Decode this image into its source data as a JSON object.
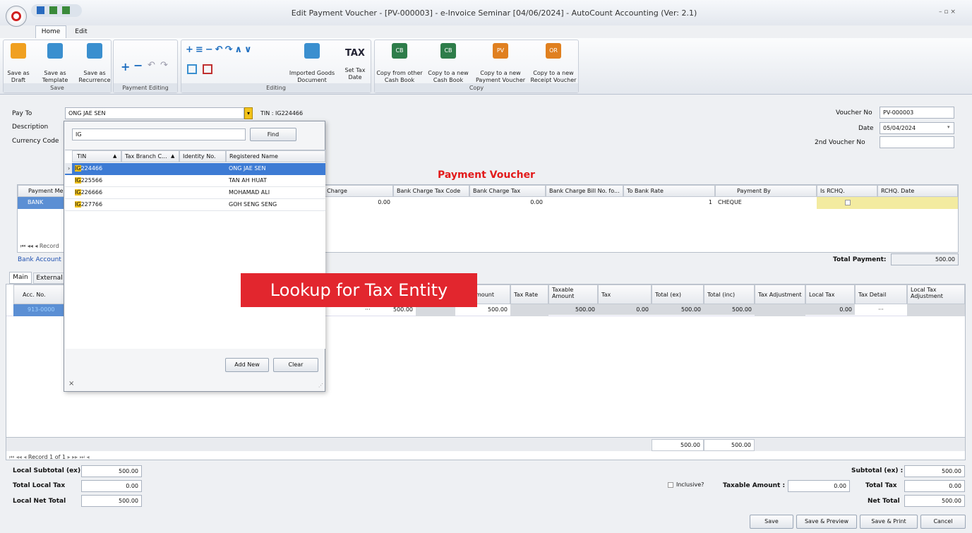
{
  "window": {
    "title": "Edit Payment Voucher - [PV-000003] - e-Invoice Seminar [04/06/2024] - AutoCount Accounting (Ver: 2.1)",
    "controls": "– ▫ ×"
  },
  "tabs": [
    "Home",
    "Edit"
  ],
  "ribbon": {
    "save_group": "Save",
    "save_draft": [
      "Save as",
      "Draft"
    ],
    "save_template": [
      "Save as",
      "Template"
    ],
    "save_recurrence": [
      "Save as",
      "Recurrence"
    ],
    "payment_editing": "Payment Editing",
    "editing": "Editing",
    "imported_goods": [
      "Imported Goods",
      "Document"
    ],
    "set_tax_date": [
      "Set Tax",
      "Date"
    ],
    "copy_group": "Copy",
    "copy_from_cash": [
      "Copy from other",
      "Cash Book"
    ],
    "copy_new_cash": [
      "Copy to a new",
      "Cash Book"
    ],
    "copy_new_pv": [
      "Copy to a new",
      "Payment Voucher"
    ],
    "copy_new_rv": [
      "Copy to a new",
      "Receipt Voucher"
    ],
    "tax_icon": "TAX",
    "cb": "CB",
    "pv": "PV",
    "or": "OR"
  },
  "form": {
    "pay_to_label": "Pay To",
    "pay_to_value": "ONG JAE SEN",
    "tin": "TIN : IG224466",
    "description_label": "Description",
    "currency_label": "Currency Code",
    "voucher_no_label": "Voucher No",
    "voucher_no": "PV-000003",
    "date_label": "Date",
    "date": "05/04/2024",
    "second_voucher_label": "2nd Voucher No"
  },
  "doc_title": "Payment Voucher",
  "payment_grid": {
    "headers": [
      "Payment Me",
      "k Charge",
      "Bank Charge Tax Code",
      "Bank Charge Tax",
      "Bank Charge Bill No. fo...",
      "To Bank Rate",
      "Payment By",
      "Is RCHQ.",
      "RCHQ. Date"
    ],
    "row": {
      "method": "BANK",
      "charge": "0.00",
      "tax": "0.00",
      "rate": "1",
      "by": "CHEQUE"
    },
    "nav": "Record",
    "bank_account": "Bank Account",
    "total_payment_label": "Total Payment:",
    "total_payment": "500.00"
  },
  "detail_tabs": [
    "Main",
    "External"
  ],
  "detail_grid": {
    "headers": [
      "Acc. No.",
      "mount",
      "Tax Rate",
      "Taxable Amount",
      "Tax",
      "Total (ex)",
      "Total (inc)",
      "Tax Adjustment",
      "Local Tax",
      "Tax Detail",
      "Local Tax Adjustment"
    ],
    "row": {
      "acc": "913-0000",
      "dots": "···",
      "amt1": "500.00",
      "amount": "500.00",
      "taxable": "500.00",
      "tax": "0.00",
      "total_ex": "500.00",
      "total_inc": "500.00",
      "local_tax": "0.00",
      "detail": "···"
    },
    "footer_ex": "500.00",
    "footer_inc": "500.00",
    "nav": "Record 1 of 1"
  },
  "lookup": {
    "search_value": "IG",
    "find": "Find",
    "headers": [
      "TIN",
      "Tax Branch C...",
      "Identity No.",
      "Registered Name"
    ],
    "rows": [
      {
        "tin_hl": "IG",
        "tin_rest": "224466",
        "name": "ONG JAE SEN"
      },
      {
        "tin_hl": "IG",
        "tin_rest": "225566",
        "name": "TAN AH HUAT"
      },
      {
        "tin_hl": "IG",
        "tin_rest": "226666",
        "name": "MOHAMAD ALI"
      },
      {
        "tin_hl": "IG",
        "tin_rest": "227766",
        "name": "GOH SENG SENG"
      }
    ],
    "add_new": "Add New",
    "clear": "Clear",
    "close": "×"
  },
  "banner": "Lookup for Tax Entity",
  "totals": {
    "local_subtotal_label": "Local Subtotal (ex)",
    "local_subtotal": "500.00",
    "total_local_tax_label": "Total Local Tax",
    "total_local_tax": "0.00",
    "local_net_label": "Local Net Total",
    "local_net": "500.00",
    "inclusive": "Inclusive?",
    "taxable_label": "Taxable Amount :",
    "taxable": "0.00",
    "subtotal_label": "Subtotal (ex) :",
    "subtotal": "500.00",
    "total_tax_label": "Total Tax",
    "total_tax": "0.00",
    "net_label": "Net Total",
    "net": "500.00"
  },
  "buttons": {
    "save": "Save",
    "save_preview": "Save & Preview",
    "save_print": "Save & Print",
    "cancel": "Cancel"
  }
}
